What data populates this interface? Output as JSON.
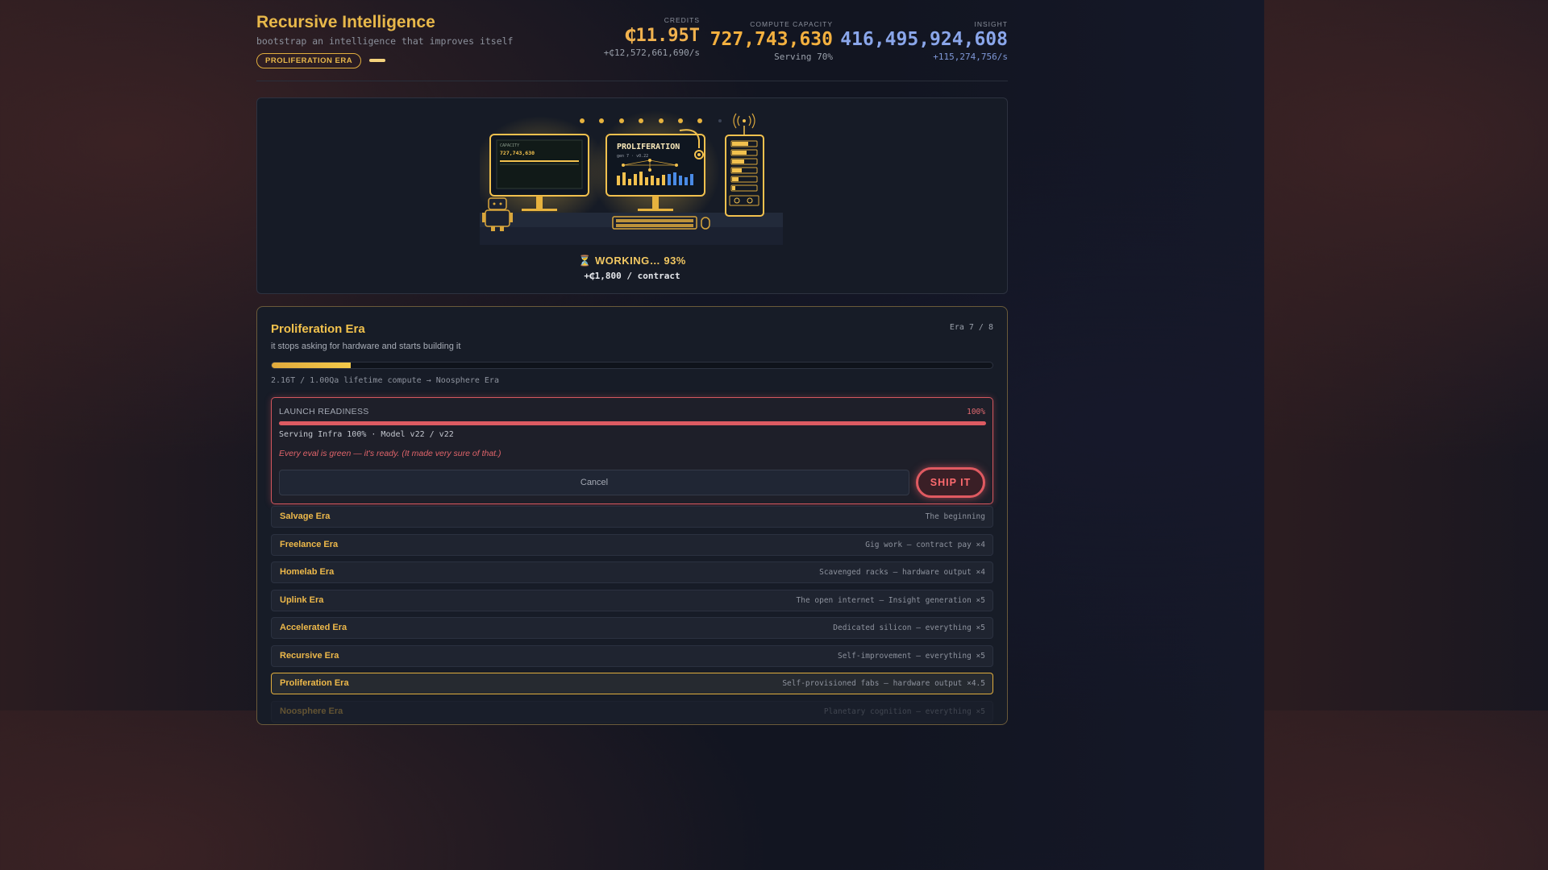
{
  "header": {
    "title": "Recursive Intelligence",
    "subtitle": "bootstrap an intelligence that improves itself",
    "era_badge": "PROLIFERATION ERA"
  },
  "stats": {
    "credits": {
      "label": "CREDITS",
      "value": "₵11.95T",
      "rate": "+₵12,572,661,690/s"
    },
    "compute": {
      "label": "COMPUTE CAPACITY",
      "value": "727,743,630",
      "sub": "Serving 70%"
    },
    "insight": {
      "label": "INSIGHT",
      "value": "416,495,924,608",
      "rate": "+115,274,756/s"
    }
  },
  "scene": {
    "monitor_left_label": "CAPACITY",
    "monitor_left_value": "727,743,630",
    "monitor_center_title": "PROLIFERATION",
    "monitor_center_sub": "gen 7 · v0.22",
    "working": "WORKING… 93%",
    "contract": "+₵1,800 / contract",
    "working_progress": 0.93
  },
  "era": {
    "title": "Proliferation Era",
    "count": "Era 7 / 8",
    "description": "it stops asking for hardware and starts building it",
    "progress_fraction": 0.11,
    "progress_text": "2.16T / 1.00Qa lifetime compute → Noosphere Era"
  },
  "launch": {
    "label": "LAUNCH READINESS",
    "percent": "100%",
    "progress_fraction": 1.0,
    "info": "Serving Infra 100% · Model v22 / v22",
    "note": "Every eval is green — it's ready. (It made very sure of that.)",
    "cancel_label": "Cancel",
    "ship_label": "SHIP IT"
  },
  "eras": [
    {
      "name": "Salvage Era",
      "desc": "The beginning",
      "state": "done"
    },
    {
      "name": "Freelance Era",
      "desc": "Gig work — contract pay ×4",
      "state": "done"
    },
    {
      "name": "Homelab Era",
      "desc": "Scavenged racks — hardware output ×4",
      "state": "done"
    },
    {
      "name": "Uplink Era",
      "desc": "The open internet — Insight generation ×5",
      "state": "done"
    },
    {
      "name": "Accelerated Era",
      "desc": "Dedicated silicon — everything ×5",
      "state": "done"
    },
    {
      "name": "Recursive Era",
      "desc": "Self-improvement — everything ×5",
      "state": "done"
    },
    {
      "name": "Proliferation Era",
      "desc": "Self-provisioned fabs — hardware output ×4.5",
      "state": "active"
    },
    {
      "name": "Noosphere Era",
      "desc": "Planetary cognition — everything ×5",
      "state": "locked"
    }
  ],
  "colors": {
    "accent": "#e8b84a",
    "danger": "#e05a61",
    "insight": "#8aa6ea"
  }
}
